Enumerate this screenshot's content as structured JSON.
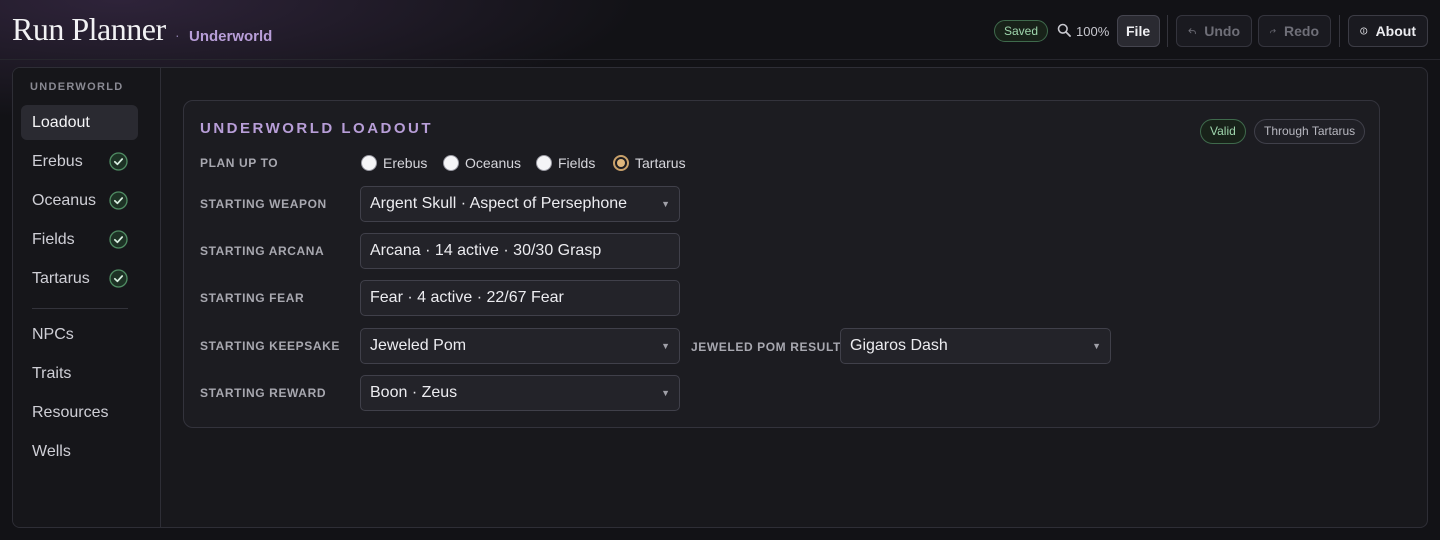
{
  "header": {
    "title": "Run Planner",
    "separator": "·",
    "subtitle": "Underworld",
    "saved_badge": "Saved",
    "zoom": "100%",
    "file_label": "File",
    "undo_label": "Undo",
    "redo_label": "Redo",
    "about_label": "About",
    "colors": {
      "accent": "#b89ed8",
      "success": "#9fd6ad"
    }
  },
  "sidebar": {
    "heading": "UNDERWORLD",
    "items": [
      {
        "label": "Loadout",
        "active": true,
        "complete": false
      },
      {
        "label": "Erebus",
        "complete": true
      },
      {
        "label": "Oceanus",
        "complete": true
      },
      {
        "label": "Fields",
        "complete": true
      },
      {
        "label": "Tartarus",
        "complete": true
      },
      {
        "label": "NPCs"
      },
      {
        "label": "Traits"
      },
      {
        "label": "Resources"
      },
      {
        "label": "Wells"
      }
    ]
  },
  "card": {
    "title": "UNDERWORLD LOADOUT",
    "valid_badge": "Valid",
    "scope_badge": "Through Tartarus",
    "plan_label": "PLAN UP TO",
    "plan_options": [
      "Erebus",
      "Oceanus",
      "Fields",
      "Tartarus"
    ],
    "plan_selected": "Tartarus",
    "weapon_label": "STARTING WEAPON",
    "weapon_value": "Argent Skull · Aspect of Persephone",
    "arcana_label": "STARTING ARCANA",
    "arcana_value": "Arcana · 14 active · 30/30 Grasp",
    "fear_label": "STARTING FEAR",
    "fear_value": "Fear · 4 active · 22/67 Fear",
    "keepsake_label": "STARTING KEEPSAKE",
    "keepsake_value": "Jeweled Pom",
    "pom_result_label": "JEWELED POM RESULT",
    "pom_result_value": "Gigaros Dash",
    "reward_label": "STARTING REWARD",
    "reward_value": "Boon · Zeus",
    "caret": "▼"
  }
}
